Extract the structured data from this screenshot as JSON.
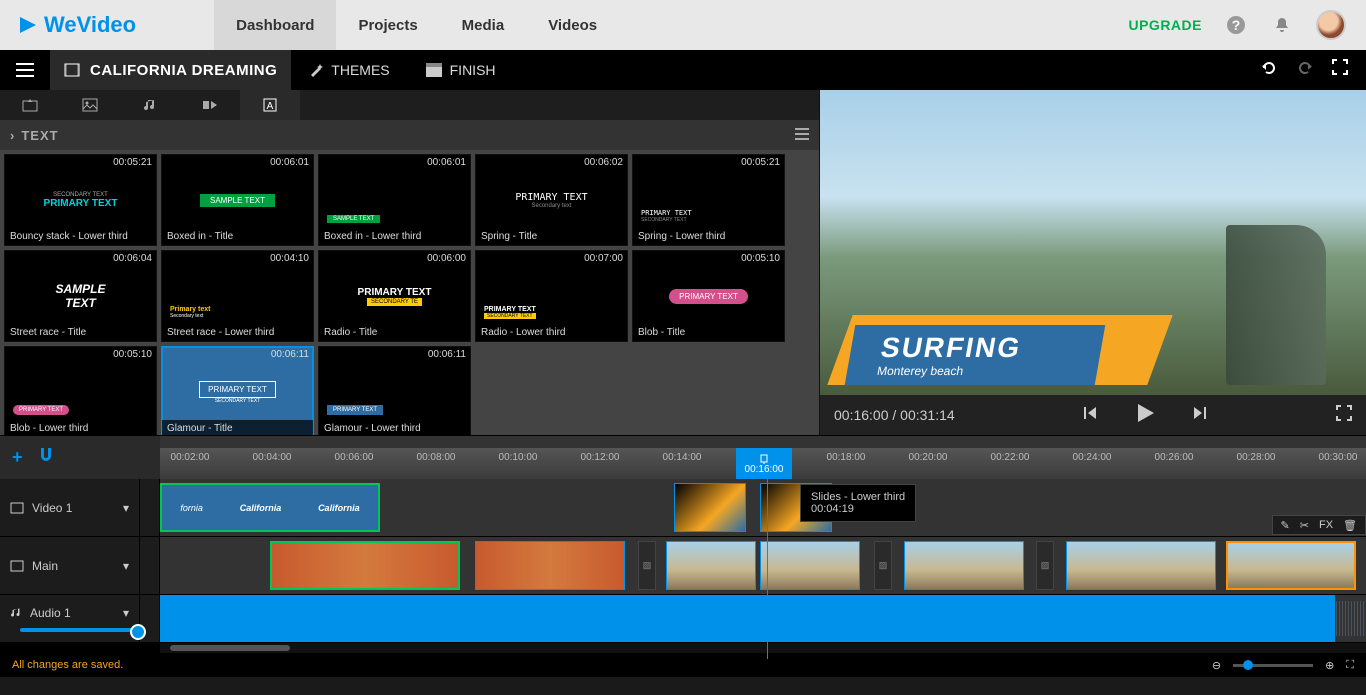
{
  "app": {
    "name": "WeVideo"
  },
  "topnav": {
    "dashboard": "Dashboard",
    "projects": "Projects",
    "media": "Media",
    "videos": "Videos",
    "upgrade": "UPGRADE"
  },
  "project": {
    "title": "CALIFORNIA DREAMING",
    "themes": "THEMES",
    "finish": "FINISH"
  },
  "panel": {
    "header": "TEXT"
  },
  "text_items": [
    {
      "name": "Bouncy stack - Lower third",
      "dur": "00:05:21"
    },
    {
      "name": "Boxed in - Title",
      "dur": "00:06:01"
    },
    {
      "name": "Boxed in - Lower third",
      "dur": "00:06:01"
    },
    {
      "name": "Spring - Title",
      "dur": "00:06:02"
    },
    {
      "name": "Spring - Lower third",
      "dur": "00:05:21"
    },
    {
      "name": "Street race - Title",
      "dur": "00:06:04"
    },
    {
      "name": "Street race - Lower third",
      "dur": "00:04:10"
    },
    {
      "name": "Radio - Title",
      "dur": "00:06:00"
    },
    {
      "name": "Radio - Lower third",
      "dur": "00:07:00"
    },
    {
      "name": "Blob - Title",
      "dur": "00:05:10"
    },
    {
      "name": "Blob - Lower third",
      "dur": "00:05:10"
    },
    {
      "name": "Glamour - Title",
      "dur": "00:06:11"
    },
    {
      "name": "Glamour - Lower third",
      "dur": "00:06:11"
    }
  ],
  "preview": {
    "title": "SURFING",
    "subtitle": "Monterey beach",
    "current": "00:16:00",
    "total": "00:31:14",
    "sep": " / "
  },
  "ruler": {
    "marks": [
      "00:02:00",
      "00:04:00",
      "00:06:00",
      "00:08:00",
      "00:10:00",
      "00:12:00",
      "00:14:00",
      "00:16:00",
      "00:18:00",
      "00:20:00",
      "00:22:00",
      "00:24:00",
      "00:26:00",
      "00:28:00",
      "00:30:00"
    ],
    "playhead": "00:16:00"
  },
  "tooltip": {
    "title": "Slides - Lower third",
    "dur": "00:04:19"
  },
  "tracks": {
    "video1": "Video 1",
    "main": "Main",
    "audio1": "Audio 1"
  },
  "clip_toolbar": {
    "fx": "FX"
  },
  "status": {
    "msg": "All changes are saved."
  },
  "colors": {
    "accent": "#0091ea",
    "upgrade": "#00b050",
    "warn": "#f5a623"
  }
}
